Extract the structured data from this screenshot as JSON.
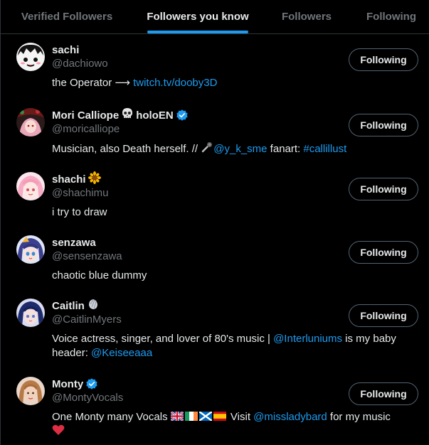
{
  "tabs": [
    {
      "label": "Verified Followers",
      "active": false
    },
    {
      "label": "Followers you know",
      "active": true
    },
    {
      "label": "Followers",
      "active": false
    },
    {
      "label": "Following",
      "active": false
    }
  ],
  "follow_label": "Following",
  "colors": {
    "background": "#000000",
    "accent": "#1d9bf0",
    "secondary_text": "#71767b",
    "border": "#2f3336"
  },
  "users": [
    {
      "name": "sachi",
      "handle": "@dachiowo",
      "bio_text": "the Operator ⟶ ",
      "bio_link": "twitch.tv/dooby3D"
    },
    {
      "name": "Mori Calliope",
      "name_suffix": "holoEN",
      "name_emoji": "skull-emoji",
      "verified": true,
      "handle": "@moricalliope",
      "bio_text": "Musician, also Death herself. // ",
      "bio_mention": "@y_k_sme",
      "bio_mid": " fanart: ",
      "bio_hashtag": "#callillust"
    },
    {
      "name": "shachi",
      "name_emoji": "sunflower-emoji",
      "handle": "@shachimu",
      "bio_text": "i try to draw"
    },
    {
      "name": "senzawa",
      "handle": "@sensenzawa",
      "bio_text": "chaotic blue dummy"
    },
    {
      "name": "Caitlin",
      "name_emoji": "shell-emoji",
      "handle": "@CaitlinMyers",
      "bio_text": "Voice actress, singer, and lover of 80's music | ",
      "bio_mention": "@Interluniums",
      "bio_mid": " is my baby",
      "bio_line2": "header: ",
      "bio_mention2": "@Keiseeaaa"
    },
    {
      "name": "Monty",
      "verified": true,
      "handle": "@MontyVocals",
      "bio_text": "One Monty many Vocals ",
      "bio_mid": " Visit ",
      "bio_mention": "@missladybard",
      "bio_end": " for my music "
    }
  ]
}
